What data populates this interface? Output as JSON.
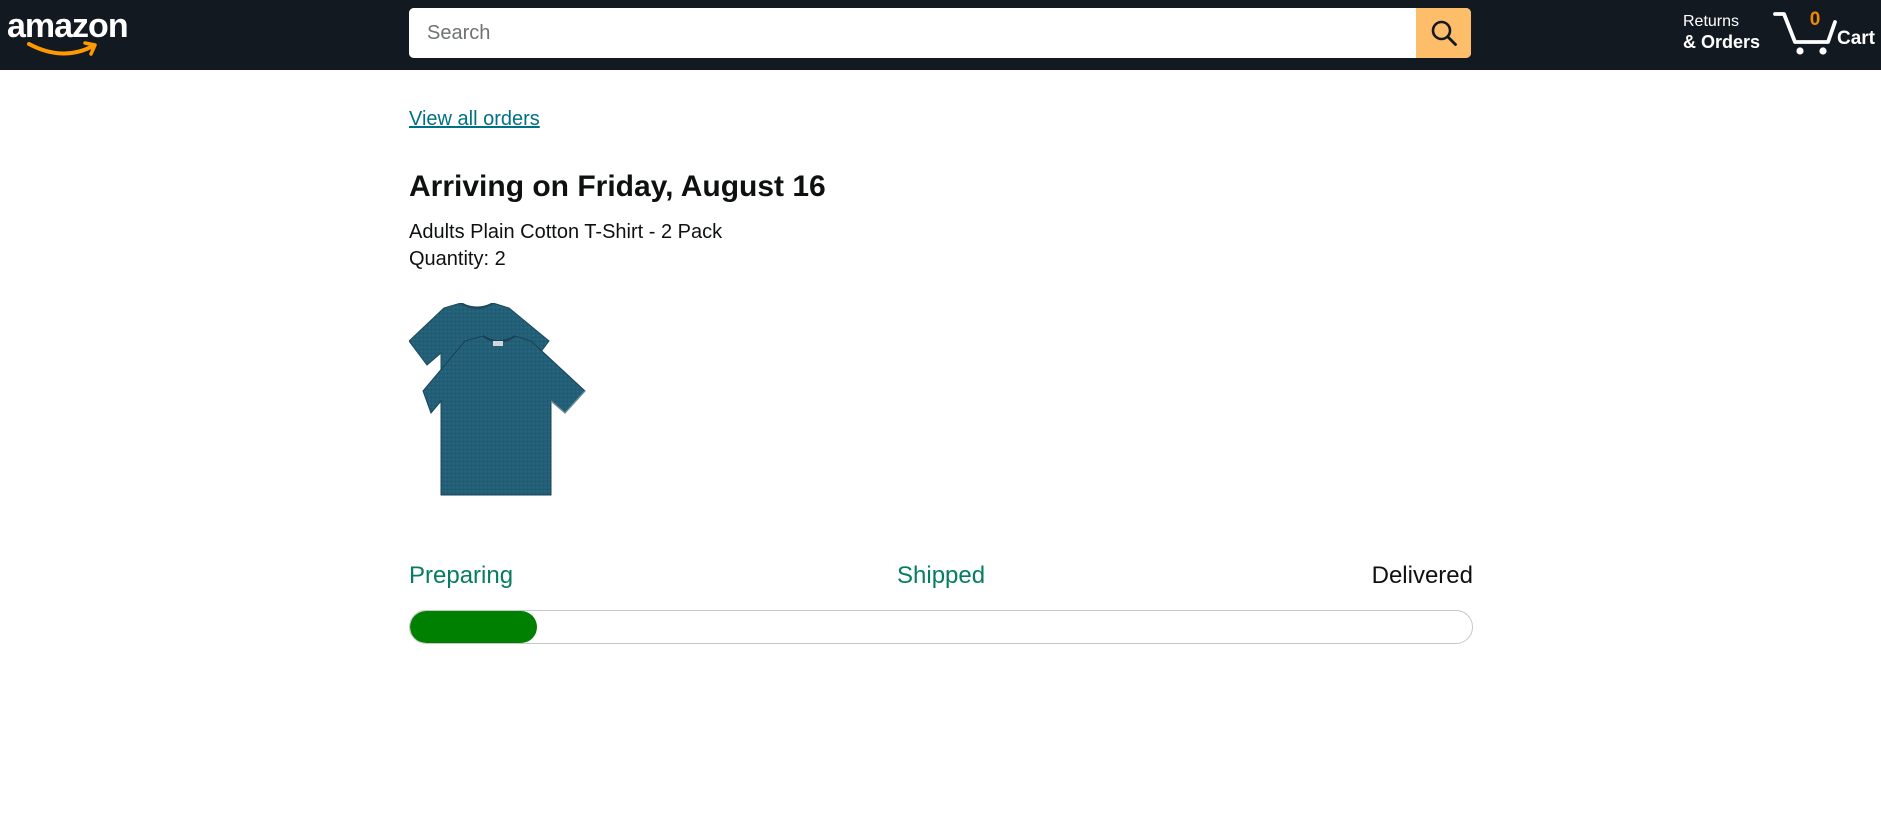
{
  "header": {
    "logo_text": "amazon",
    "search": {
      "placeholder": "Search",
      "value": "",
      "button_icon": "search-icon"
    },
    "returns": {
      "line1": "Returns",
      "line2": "& Orders"
    },
    "cart": {
      "count": "0",
      "label": "Cart",
      "icon": "cart-icon"
    }
  },
  "order": {
    "view_all_link": "View all orders",
    "arrival_heading": "Arriving on Friday, August 16",
    "product_name": "Adults Plain Cotton T-Shirt - 2 Pack",
    "quantity_text": "Quantity: 2",
    "image_alt": "t-shirt-image"
  },
  "tracking": {
    "steps": [
      {
        "label": "Preparing",
        "state": "done"
      },
      {
        "label": "Shipped",
        "state": "done"
      },
      {
        "label": "Delivered",
        "state": "pending"
      }
    ],
    "progress_percent": 12
  },
  "colors": {
    "topbar": "#131921",
    "search_button": "#febd69",
    "cart_count": "#f08804",
    "link": "#007185",
    "step_done": "#067d62",
    "progress_fill": "#008000"
  }
}
